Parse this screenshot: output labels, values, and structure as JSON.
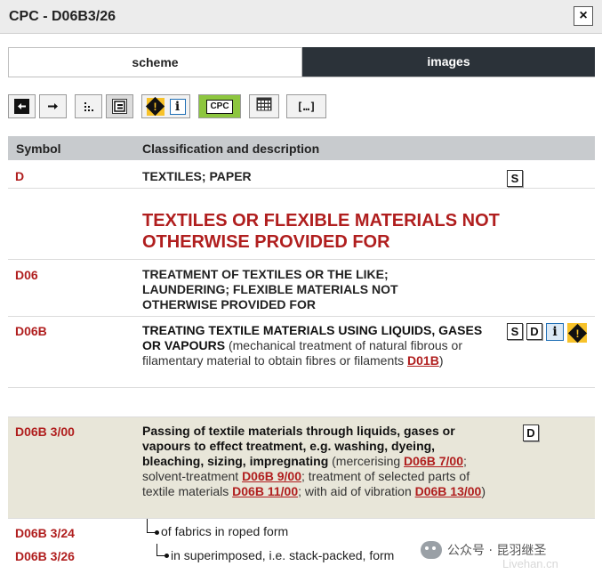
{
  "window": {
    "title": "CPC - D06B3/26",
    "close_glyph": "×"
  },
  "tabs": [
    {
      "label": "scheme",
      "active": true
    },
    {
      "label": "images",
      "active": false
    }
  ],
  "toolbar": {
    "cpc_label": "CPC",
    "bracket_label": "[…]"
  },
  "table": {
    "col_symbol": "Symbol",
    "col_description": "Classification and description"
  },
  "rows": {
    "d": {
      "symbol": "D",
      "title": "TEXTILES; PAPER"
    },
    "section": {
      "title": "TEXTILES OR FLEXIBLE MATERIALS NOT OTHERWISE PROVIDED FOR"
    },
    "d06": {
      "symbol": "D06",
      "title": "TREATMENT OF TEXTILES OR THE LIKE; LAUNDERING; FLEXIBLE MATERIALS NOT OTHERWISE PROVIDED FOR"
    },
    "d06b": {
      "symbol": "D06B",
      "title": "TREATING TEXTILE MATERIALS USING LIQUIDS, GASES OR VAPOURS",
      "note": " (mechanical treatment of natural fibrous or filamentary material to obtain fibres or filaments ",
      "ref": "D01B",
      "close": ")"
    },
    "d06b300": {
      "symbol": "D06B 3/00",
      "title": "Passing of textile materials through liquids, gases or vapours to effect treatment, e.g. washing, dyeing, bleaching, sizing, impregnating",
      "n1": " (mercerising ",
      "r1": "D06B 7/00",
      "n2": "; solvent-treatment ",
      "r2": "D06B 9/00",
      "n3": "; treatment of selected parts of textile materials ",
      "r3": "D06B 11/00",
      "n4": "; with aid of vibration ",
      "r4": "D06B 13/00",
      "n5": ")"
    },
    "d06b324": {
      "symbol": "D06B 3/24",
      "title": "of fabrics in roped form"
    },
    "d06b326": {
      "symbol": "D06B 3/26",
      "title": "in superimposed, i.e. stack-packed, form"
    }
  },
  "icons": {
    "s_label": "S",
    "d_label": "D",
    "i_label": "i",
    "warn_label": "!"
  },
  "watermark": {
    "text": "公众号 · 昆羽继圣",
    "faint": "Livehan.cn"
  }
}
